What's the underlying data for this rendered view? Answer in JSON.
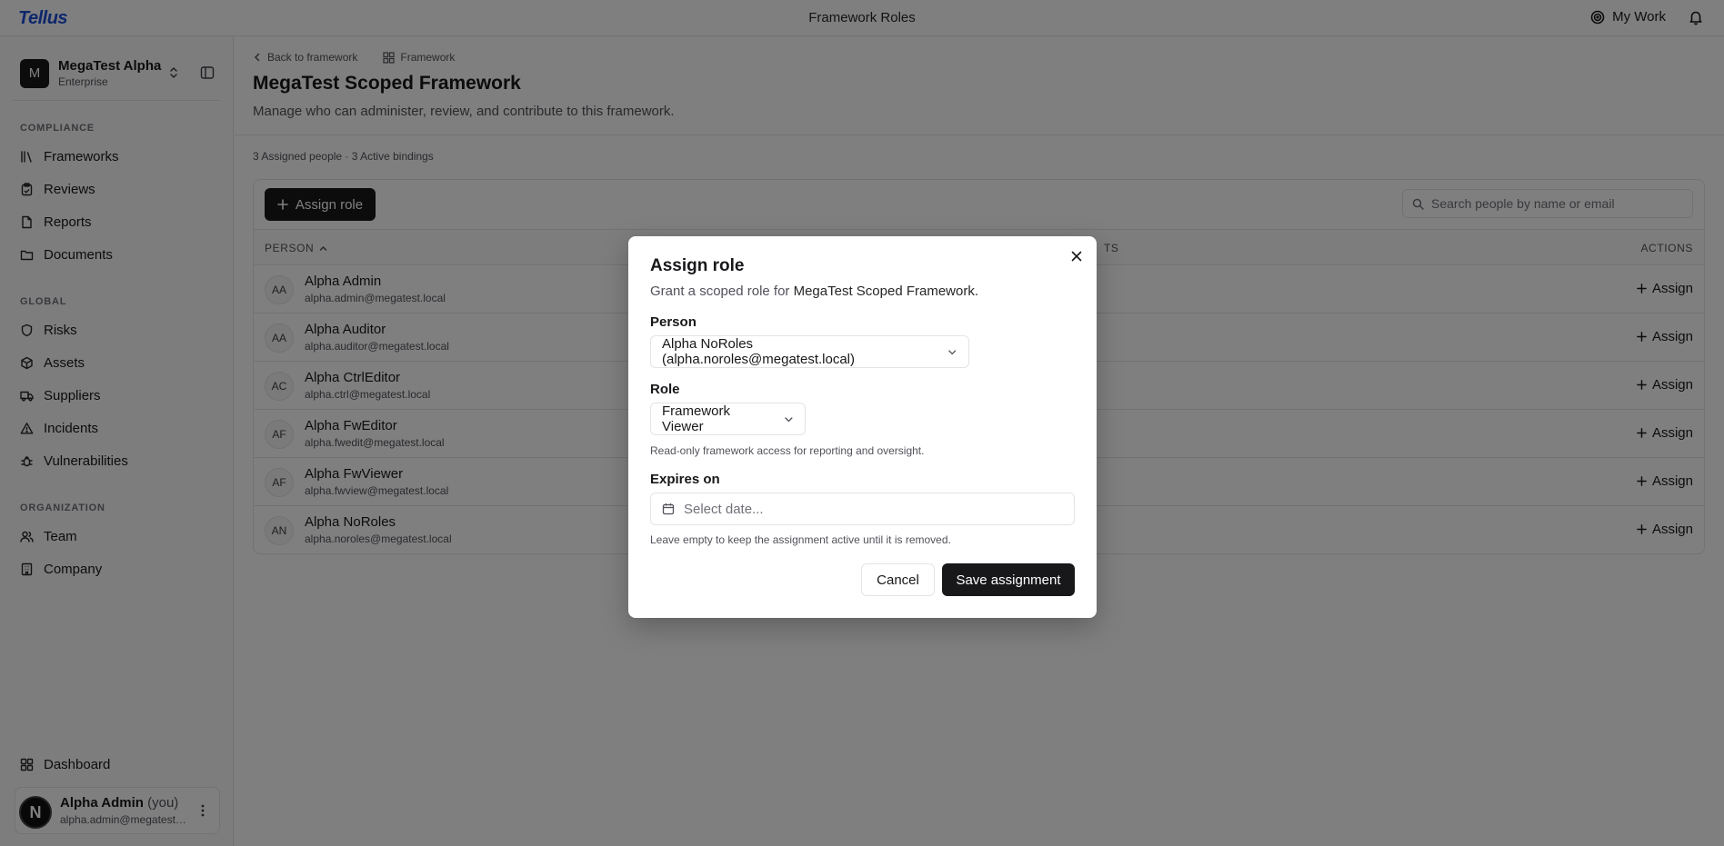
{
  "topbar": {
    "logo": "Tellus",
    "title": "Framework Roles",
    "my_work": "My Work"
  },
  "sidebar": {
    "org_initial": "M",
    "org_name": "MegaTest Alpha",
    "org_plan": "Enterprise",
    "sections": [
      {
        "label": "COMPLIANCE",
        "items": [
          {
            "label": "Frameworks",
            "icon": "library-icon"
          },
          {
            "label": "Reviews",
            "icon": "clipboard-check-icon"
          },
          {
            "label": "Reports",
            "icon": "file-icon"
          },
          {
            "label": "Documents",
            "icon": "folder-icon"
          }
        ]
      },
      {
        "label": "GLOBAL",
        "items": [
          {
            "label": "Risks",
            "icon": "shield-icon"
          },
          {
            "label": "Assets",
            "icon": "box-icon"
          },
          {
            "label": "Suppliers",
            "icon": "truck-icon"
          },
          {
            "label": "Incidents",
            "icon": "alert-triangle-icon"
          },
          {
            "label": "Vulnerabilities",
            "icon": "bug-icon"
          }
        ]
      },
      {
        "label": "ORGANIZATION",
        "items": [
          {
            "label": "Team",
            "icon": "users-icon"
          },
          {
            "label": "Company",
            "icon": "building-icon"
          }
        ]
      }
    ],
    "dashboard": "Dashboard",
    "user": {
      "initial": "N",
      "name": "Alpha Admin",
      "you": "(you)",
      "email": "alpha.admin@megatest.local"
    }
  },
  "main": {
    "back": "Back to framework",
    "framework_crumb": "Framework",
    "title": "MegaTest Scoped Framework",
    "description": "Manage who can administer, review, and contribute to this framework.",
    "stats": "3 Assigned people · 3 Active bindings",
    "assign_role_label": "Assign role",
    "search_placeholder": "Search people by name or email",
    "columns": {
      "person": "PERSON",
      "assignments": "TS",
      "actions": "ACTIONS"
    },
    "rows": [
      {
        "initials": "AA",
        "name": "Alpha Admin",
        "email": "alpha.admin@megatest.local",
        "assign": "Assign"
      },
      {
        "initials": "AA",
        "name": "Alpha Auditor",
        "email": "alpha.auditor@megatest.local",
        "assign": "Assign"
      },
      {
        "initials": "AC",
        "name": "Alpha CtrlEditor",
        "email": "alpha.ctrl@megatest.local",
        "assign": "Assign"
      },
      {
        "initials": "AF",
        "name": "Alpha FwEditor",
        "email": "alpha.fwedit@megatest.local",
        "assign": "Assign"
      },
      {
        "initials": "AF",
        "name": "Alpha FwViewer",
        "email": "alpha.fwview@megatest.local",
        "assign": "Assign"
      },
      {
        "initials": "AN",
        "name": "Alpha NoRoles",
        "email": "alpha.noroles@megatest.local",
        "assign": "Assign"
      }
    ]
  },
  "modal": {
    "title": "Assign role",
    "subtitle_prefix": "Grant a scoped role for",
    "subtitle_framework": "MegaTest Scoped Framework.",
    "person_label": "Person",
    "person_value": "Alpha NoRoles (alpha.noroles@megatest.local)",
    "role_label": "Role",
    "role_value": "Framework Viewer",
    "role_hint": "Read-only framework access for reporting and oversight.",
    "expires_label": "Expires on",
    "expires_placeholder": "Select date...",
    "expires_hint": "Leave empty to keep the assignment active until it is removed.",
    "cancel": "Cancel",
    "save": "Save assignment"
  }
}
